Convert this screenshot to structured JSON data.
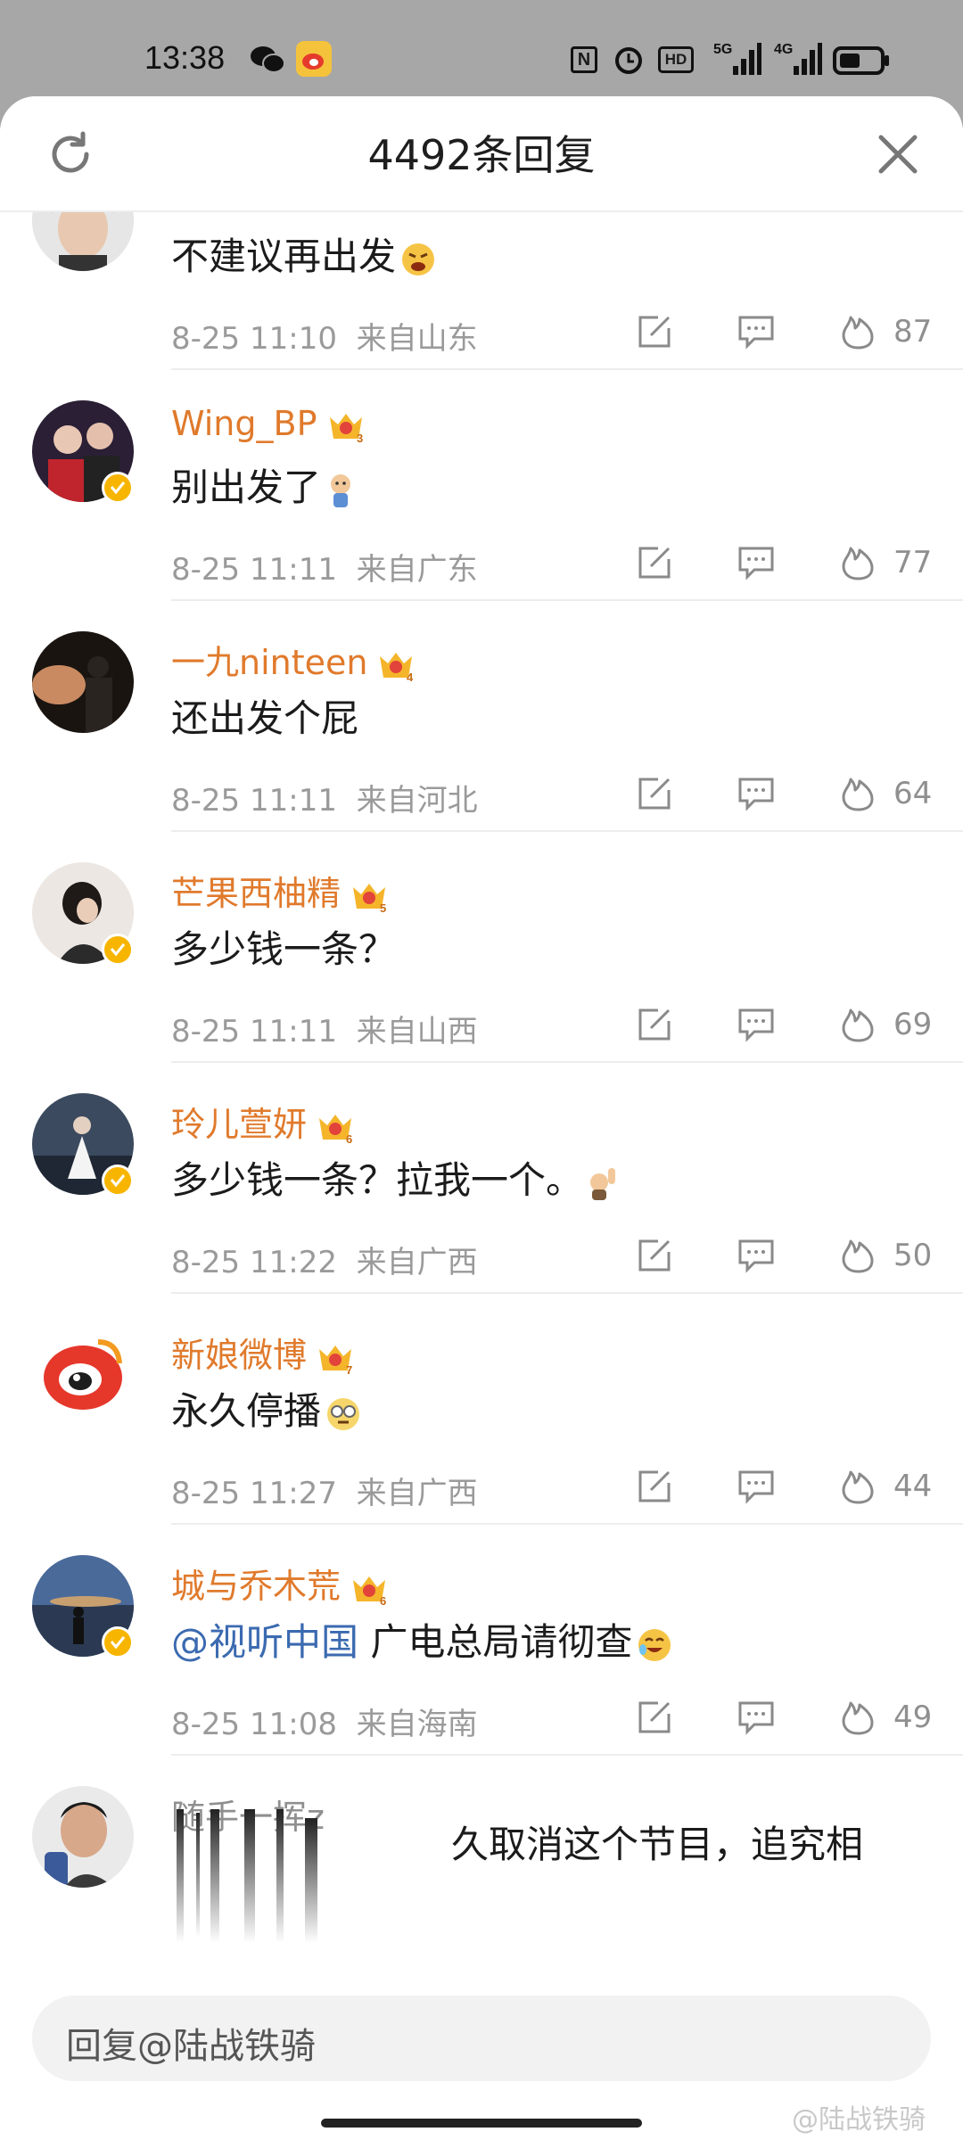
{
  "status_bar": {
    "time": "13:38",
    "app_icons": [
      "wechat-icon",
      "weibo-icon"
    ],
    "right_icons": [
      "nfc-icon",
      "alarm-icon",
      "hd-icon",
      "signal-5g-icon",
      "signal-4g-icon",
      "battery-icon"
    ]
  },
  "header": {
    "title": "4492条回复",
    "left_icon": "refresh-icon",
    "right_icon": "close-icon"
  },
  "comments": [
    {
      "username": "",
      "text": "不建议再出发",
      "emoji": "angry-emoji",
      "time": "8-25 11:10",
      "location": "来自山东",
      "likes": "87"
    },
    {
      "username": "Wing_BP",
      "level": "3",
      "text": "别出发了",
      "emoji": "sad-emoji",
      "time": "8-25 11:11",
      "location": "来自广东",
      "likes": "77"
    },
    {
      "username": "一九ninteen",
      "level": "4",
      "text": "还出发个屁",
      "time": "8-25 11:11",
      "location": "来自河北",
      "likes": "64"
    },
    {
      "username": "芒果西柚精",
      "level": "5",
      "text": "多少钱一条？",
      "time": "8-25 11:11",
      "location": "来自山西",
      "likes": "69"
    },
    {
      "username": "玲儿萱妍",
      "level": "6",
      "text": "多少钱一条？拉我一个。",
      "emoji": "raise-hand-emoji",
      "time": "8-25 11:22",
      "location": "来自广西",
      "likes": "50"
    },
    {
      "username": "新娘微博",
      "level": "7",
      "text": "永久停播",
      "emoji": "tired-emoji",
      "time": "8-25 11:27",
      "location": "来自广西",
      "likes": "44"
    },
    {
      "username": "城与乔木荒",
      "level": "6",
      "mention": "@视听中国",
      "text": " 广电总局请彻查",
      "emoji": "laugh-emoji",
      "time": "8-25 11:08",
      "location": "来自海南",
      "likes": "49"
    },
    {
      "username": "随手一挥z",
      "text": "久取消这个节目，追究相"
    }
  ],
  "reply": {
    "placeholder": "回复@陆战铁骑"
  },
  "watermark": "@陆战铁骑",
  "colors": {
    "username": "#e07a2c",
    "mention": "#3b6ab0",
    "meta": "#9a9a9a",
    "verified_badge": "#f7b500"
  }
}
